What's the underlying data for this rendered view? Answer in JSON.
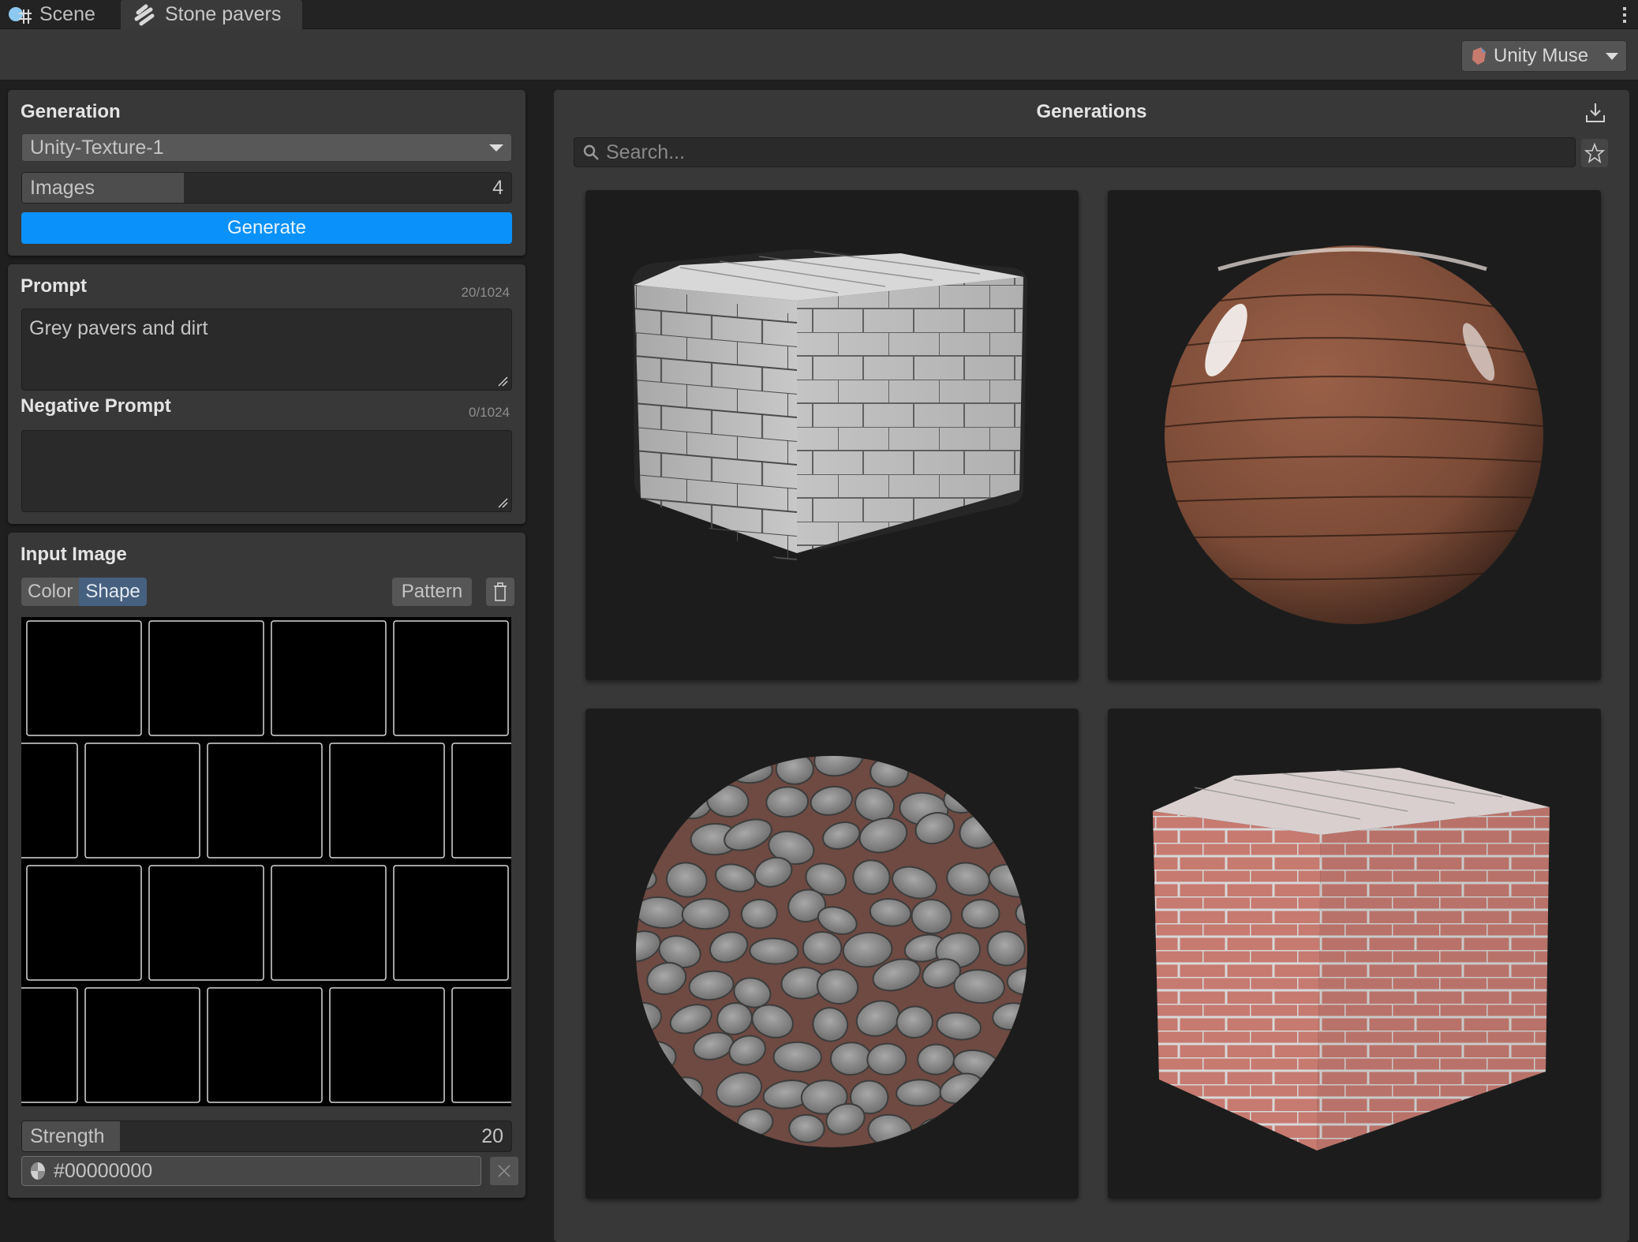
{
  "tabs": [
    {
      "label": "Scene",
      "icon": "scene-icon",
      "active": false
    },
    {
      "label": "Stone pavers",
      "icon": "texture-asset-icon",
      "active": true
    }
  ],
  "toolbar": {
    "muse_label": "Unity Muse",
    "muse_icon": "unity-muse-icon"
  },
  "generation": {
    "title": "Generation",
    "model": "Unity-Texture-1",
    "images_label": "Images",
    "images_value": "4",
    "images_fraction": 0.33,
    "generate_label": "Generate"
  },
  "prompt": {
    "title": "Prompt",
    "counter": "20/1024",
    "value": "Grey pavers and dirt",
    "negative_title": "Negative Prompt",
    "negative_counter": "0/1024",
    "negative_value": ""
  },
  "input_image": {
    "title": "Input Image",
    "modes": [
      "Color",
      "Shape"
    ],
    "active_mode": "Shape",
    "pattern_label": "Pattern",
    "strength_label": "Strength",
    "strength_value": "20",
    "strength_fraction": 0.2,
    "color_value": "#00000000"
  },
  "gallery": {
    "title": "Generations",
    "search_placeholder": "Search...",
    "items": [
      {
        "name": "grey-paver-cube",
        "shape": "cube",
        "material": "grey pavers"
      },
      {
        "name": "wood-sphere",
        "shape": "sphere",
        "material": "wood planks"
      },
      {
        "name": "cobblestone-sphere",
        "shape": "sphere",
        "material": "grey cobblestone"
      },
      {
        "name": "red-brick-cube",
        "shape": "cube",
        "material": "red brick"
      }
    ]
  },
  "colors": {
    "accent": "#0a91fa",
    "active_segment": "#46607f",
    "panel": "#383838",
    "card": "#1c1c1c"
  }
}
